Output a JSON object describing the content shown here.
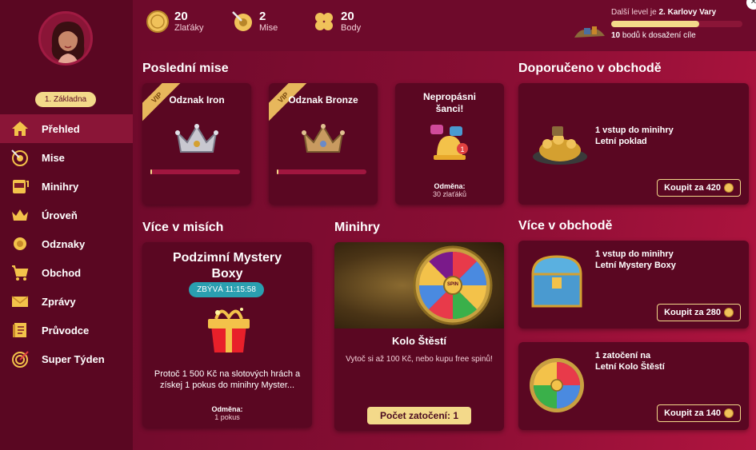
{
  "sidebar": {
    "level_badge": "1. Základna",
    "items": [
      {
        "label": "Přehled",
        "icon": "home-icon",
        "active": true
      },
      {
        "label": "Mise",
        "icon": "target-arrow-icon",
        "active": false
      },
      {
        "label": "Minihry",
        "icon": "slot-machine-icon",
        "active": false
      },
      {
        "label": "Úroveň",
        "icon": "crown-icon",
        "active": false
      },
      {
        "label": "Odznaky",
        "icon": "medal-icon",
        "active": false
      },
      {
        "label": "Obchod",
        "icon": "cart-icon",
        "active": false
      },
      {
        "label": "Zprávy",
        "icon": "envelope-icon",
        "active": false
      },
      {
        "label": "Průvodce",
        "icon": "book-icon",
        "active": false
      },
      {
        "label": "Super Týden",
        "icon": "target-icon",
        "active": false
      }
    ]
  },
  "topbar": {
    "stats": [
      {
        "value": "20",
        "label": "Zlaťáky",
        "icon": "coin-icon"
      },
      {
        "value": "2",
        "label": "Mise",
        "icon": "target-arrow-icon"
      },
      {
        "value": "20",
        "label": "Body",
        "icon": "clover-icon"
      }
    ],
    "level": {
      "prefix": "Další level je",
      "name": "2. Karlovy Vary",
      "progress": 0.67,
      "points": "10",
      "points_suffix": "bodů k dosažení cíle"
    }
  },
  "sections": {
    "recent_missions": "Poslední mise",
    "recommended_shop": "Doporučeno v obchodě",
    "more_missions": "Více v misích",
    "minigames": "Minihry",
    "more_shop": "Více v obchodě"
  },
  "missions": [
    {
      "title": "Odznak Iron",
      "vip": "VIP",
      "progress": 0.02,
      "crown": "silver"
    },
    {
      "title": "Odznak Bronze",
      "vip": "VIP",
      "progress": 0.02,
      "crown": "bronze"
    },
    {
      "title": "Nepropásni šanci!",
      "reward_label": "Odměna:",
      "reward_value": "30 zlaťáků"
    }
  ],
  "recommended": {
    "text_line1": "1 vstup do minihry",
    "text_line2": "Letní poklad",
    "button": "Koupit za 420"
  },
  "more_missions": {
    "title": "Podzimní Mystery Boxy",
    "timer": "ZBÝVÁ 11:15:58",
    "desc": "Protoč 1 500 Kč na slotových hrách a získej 1 pokus do minihry Myster...",
    "reward_label": "Odměna:",
    "reward_value": "1 pokus"
  },
  "minigame": {
    "wheel_center": "SPIN",
    "title": "Kolo Štěstí",
    "desc": "Vytoč si až 100 Kč, nebo kupu free spinů!",
    "button": "Počet zatočení: 1"
  },
  "shop": [
    {
      "line1": "1 vstup do minihry",
      "line2": "Letní Mystery Boxy",
      "button": "Koupit za 280"
    },
    {
      "line1": "1 zatočení na",
      "line2": "Letní Kolo Štěstí",
      "button": "Koupit za 140"
    }
  ],
  "colors": {
    "accent": "#f3d98a",
    "bg": "#6e0a2b",
    "card": "#5a0722",
    "timer": "#2a9fb0"
  }
}
